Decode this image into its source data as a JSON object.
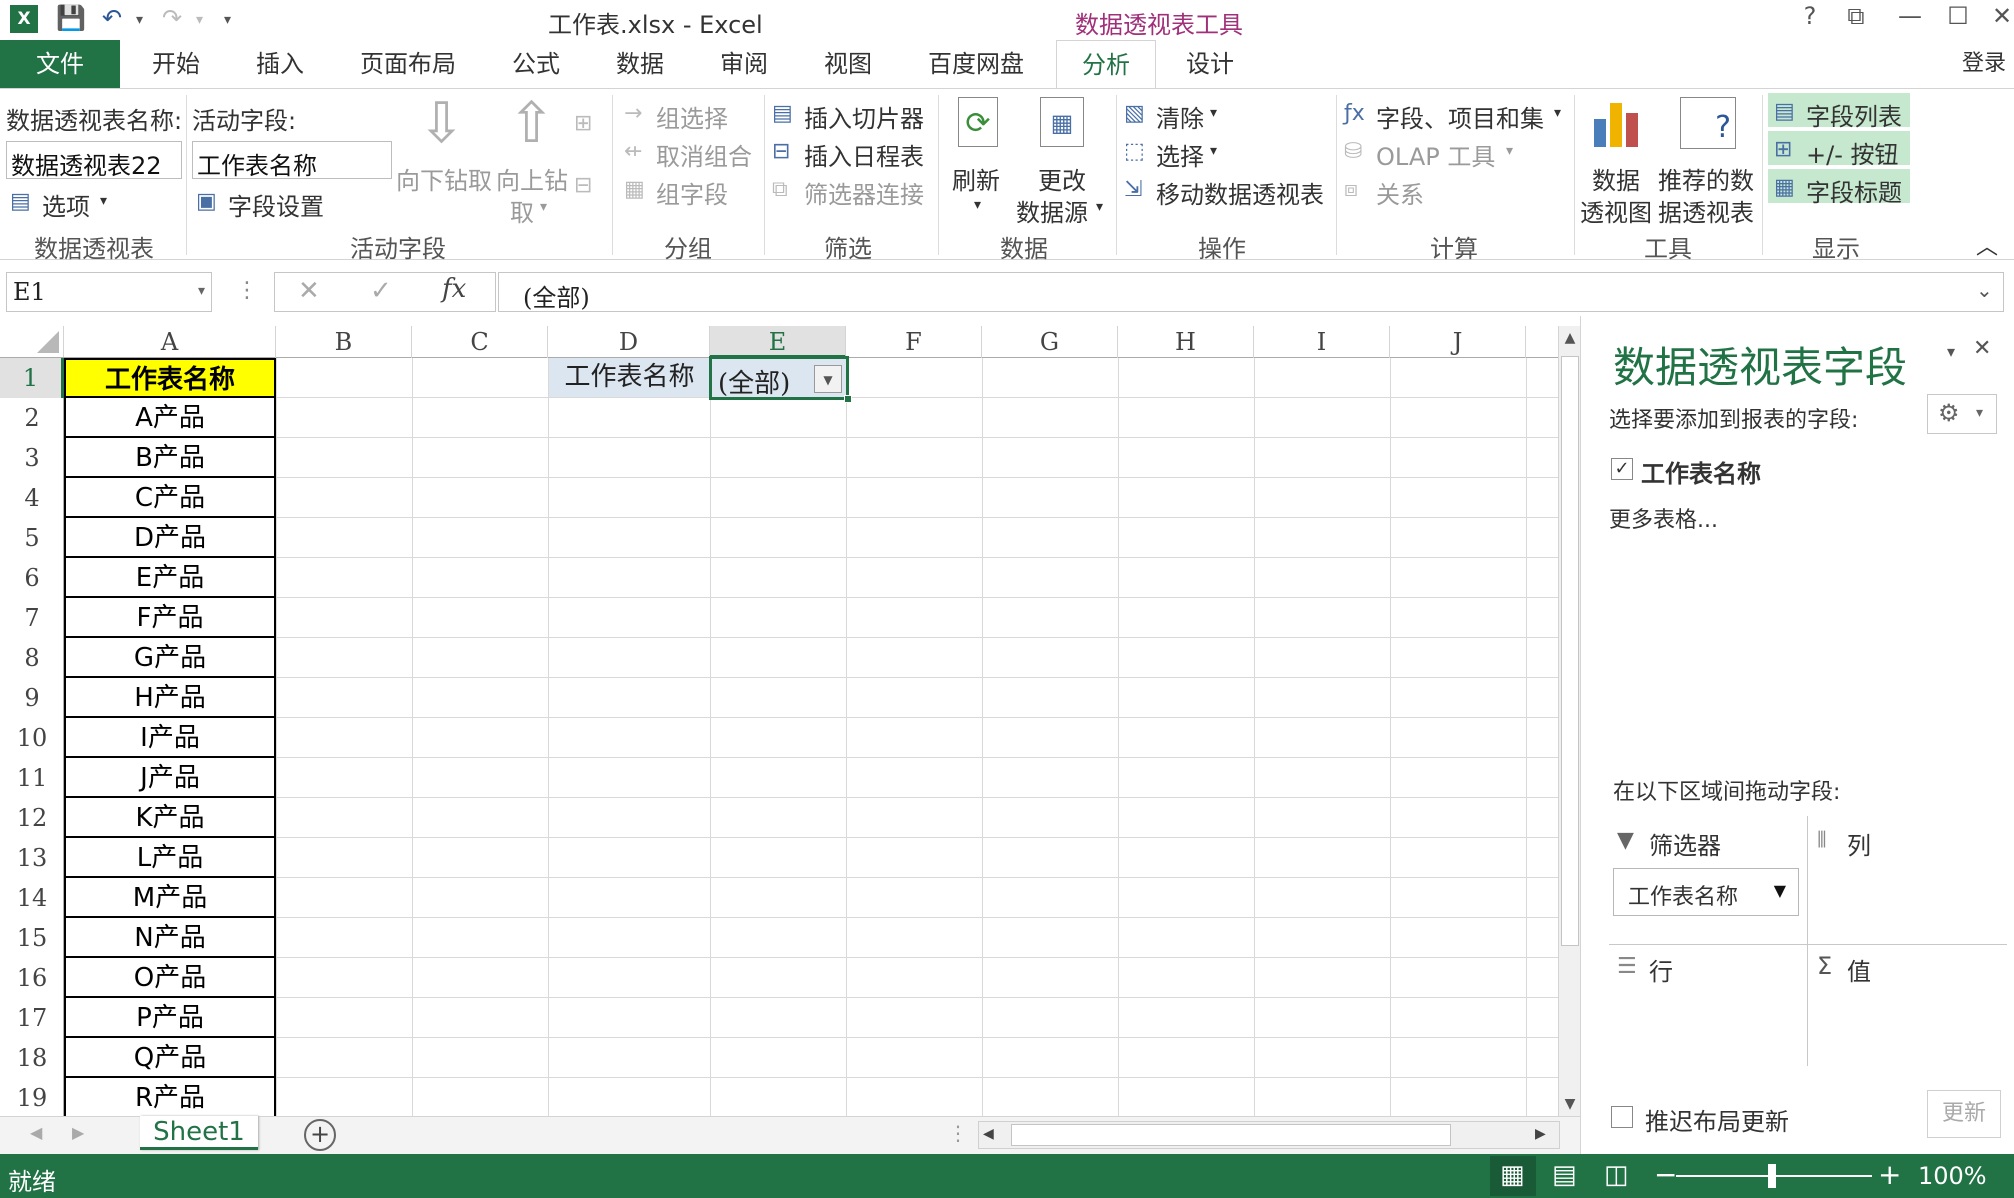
{
  "window": {
    "title": "工作表.xlsx - Excel",
    "context_tools": "数据透视表工具",
    "login": "登录",
    "help": "?"
  },
  "tabs": [
    "文件",
    "开始",
    "插入",
    "页面布局",
    "公式",
    "数据",
    "审阅",
    "视图",
    "百度网盘",
    "分析",
    "设计"
  ],
  "active_tab": "分析",
  "ribbon": {
    "pivot_name_label": "数据透视表名称:",
    "pivot_name_value": "数据透视表22",
    "options": "选项",
    "active_field_label": "活动字段:",
    "active_field_value": "工作表名称",
    "field_settings": "字段设置",
    "drill_down": "向下钻取",
    "drill_up": "向上钻",
    "drill_up2": "取",
    "group_selection": "组选择",
    "ungroup": "取消组合",
    "group_field": "组字段",
    "insert_slicer": "插入切片器",
    "insert_timeline": "插入日程表",
    "filter_connections": "筛选器连接",
    "refresh": "刷新",
    "change_source": "更改",
    "change_source2": "数据源",
    "clear": "清除",
    "select": "选择",
    "move_pivot": "移动数据透视表",
    "fields_items_sets": "字段、项目和集",
    "olap_tools": "OLAP 工具",
    "relationships": "关系",
    "pivot_chart": "数据",
    "pivot_chart2": "透视图",
    "recommended": "推荐的数",
    "recommended2": "据透视表",
    "field_list": "字段列表",
    "buttons": "+/- 按钮",
    "field_headers": "字段标题",
    "groups": [
      "数据透视表",
      "活动字段",
      "分组",
      "筛选",
      "数据",
      "操作",
      "计算",
      "工具",
      "显示"
    ]
  },
  "formula": {
    "namebox": "E1",
    "fx": "fx",
    "content": "(全部)"
  },
  "columns": [
    "A",
    "B",
    "C",
    "D",
    "E",
    "F",
    "G",
    "H",
    "I",
    "J"
  ],
  "rows": [
    "1",
    "2",
    "3",
    "4",
    "5",
    "6",
    "7",
    "8",
    "9",
    "10",
    "11",
    "12",
    "13",
    "14",
    "15",
    "16",
    "17",
    "18",
    "19"
  ],
  "cells": {
    "a_header": "工作表名称",
    "a_values": [
      "A产品",
      "B产品",
      "C产品",
      "D产品",
      "E产品",
      "F产品",
      "G产品",
      "H产品",
      "I产品",
      "J产品",
      "K产品",
      "L产品",
      "M产品",
      "N产品",
      "O产品",
      "P产品",
      "Q产品",
      "R产品"
    ],
    "d1": "工作表名称",
    "e1": "(全部)"
  },
  "sheet_tab": "Sheet1",
  "pane": {
    "title": "数据透视表字段",
    "choose": "选择要添加到报表的字段:",
    "field": "工作表名称",
    "more": "更多表格...",
    "drag": "在以下区域间拖动字段:",
    "filters": "筛选器",
    "columns": "列",
    "rows": "行",
    "values": "值",
    "filter_item": "工作表名称",
    "defer": "推迟布局更新",
    "update": "更新",
    "sigma": "Σ"
  },
  "status": {
    "ready": "就绪",
    "zoom": "100%"
  },
  "colors": {
    "excel_green": "#217346",
    "header_yellow": "#ffff00",
    "pivot_blue": "#dce6f1"
  }
}
